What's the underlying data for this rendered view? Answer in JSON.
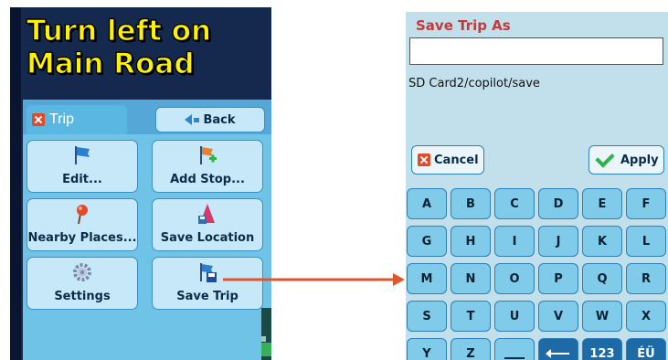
{
  "left_screen": {
    "banner": {
      "line1": "Turn left on",
      "line2": "Main Road"
    },
    "trip_tab_label": "Trip",
    "back_label": "Back",
    "tiles": [
      {
        "label": "Edit...",
        "icon": "flag-icon"
      },
      {
        "label": "Add Stop...",
        "icon": "add-stop-flag-icon"
      },
      {
        "label": "Nearby Places...",
        "icon": "pin-icon"
      },
      {
        "label": "Save Location",
        "icon": "save-location-icon"
      },
      {
        "label": "Settings",
        "icon": "gear-icon"
      },
      {
        "label": "Save Trip",
        "icon": "save-trip-icon"
      }
    ]
  },
  "right_screen": {
    "title": "Save Trip As",
    "input_value": "",
    "path": "SD Card2/copilot/save",
    "cancel_label": "Cancel",
    "apply_label": "Apply",
    "keys": {
      "row1": [
        "A",
        "B",
        "C",
        "D",
        "E",
        "F"
      ],
      "row2": [
        "G",
        "H",
        "I",
        "J",
        "K",
        "L"
      ],
      "row3": [
        "M",
        "N",
        "O",
        "P",
        "Q",
        "R"
      ],
      "row4": [
        "S",
        "T",
        "U",
        "V",
        "W",
        "X"
      ],
      "row5": [
        "Y",
        "Z",
        "",
        "",
        "123",
        "ÉÜ"
      ]
    }
  },
  "colors": {
    "banner_text": "#fff200",
    "panel_bg": "#6fc3e6",
    "key_bg": "#7fcbe9",
    "title_red": "#c23a3a",
    "connector": "#e0552d"
  }
}
